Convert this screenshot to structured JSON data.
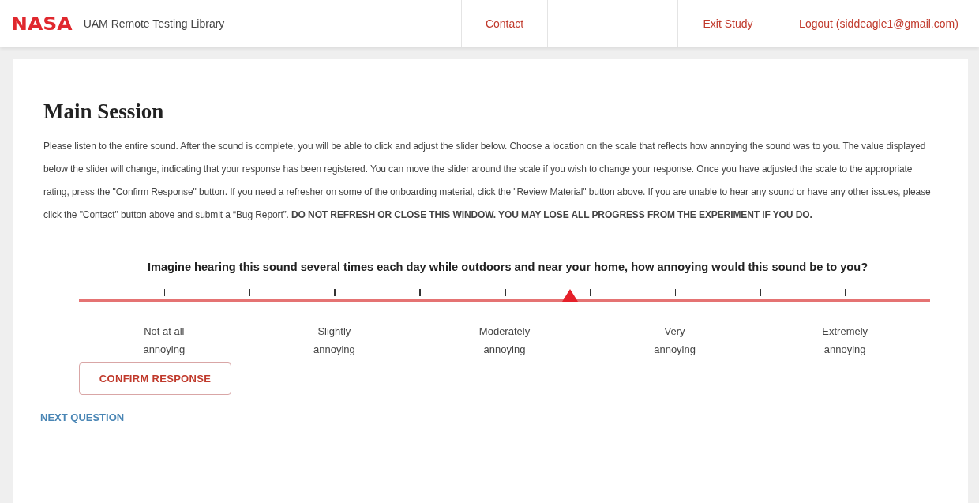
{
  "navbar": {
    "logo": "NASA",
    "title": "UAM Remote Testing Library",
    "links": [
      {
        "label": "Contact"
      },
      {
        "label": "Exit Study"
      },
      {
        "label": "Logout (siddeagle1@gmail.com)"
      }
    ]
  },
  "page": {
    "heading": "Main Session",
    "instructions": "Please listen to the entire sound. After the sound is complete, you will be able to click and adjust the slider below. Choose a location on the scale that reflects how annoying the sound was to you. The value displayed below the slider will change, indicating that your response has been registered. You can move the slider around the scale if you wish to change your response. Once you have adjusted the scale to the appropriate rating, press the \"Confirm Response\" button. If you need a refresher on some of the onboarding material, click the \"Review Material\" button above. If you are unable to hear any sound or have any other issues, please click the \"Contact\" button above and submit a “Bug Report”. **DO NOT REFRESH OR CLOSE THIS WINDOW. YOU MAY LOSE ALL PROGRESS FROM THE EXPERIMENT IF YOU DO.**",
    "question": "Imagine hearing this sound several times each day while outdoors and near your home, how annoying would this sound be to you?",
    "slider": {
      "level": 0.577,
      "labels": [
        [
          "Not at all",
          "annoying"
        ],
        [
          "Slightly",
          "annoying"
        ],
        [
          "Moderately",
          "annoying"
        ],
        [
          "Very",
          "annoying"
        ],
        [
          "Extremely",
          "annoying"
        ]
      ]
    },
    "confirm_button": "CONFIRM RESPONSE",
    "next_link": "NEXT QUESTION"
  }
}
